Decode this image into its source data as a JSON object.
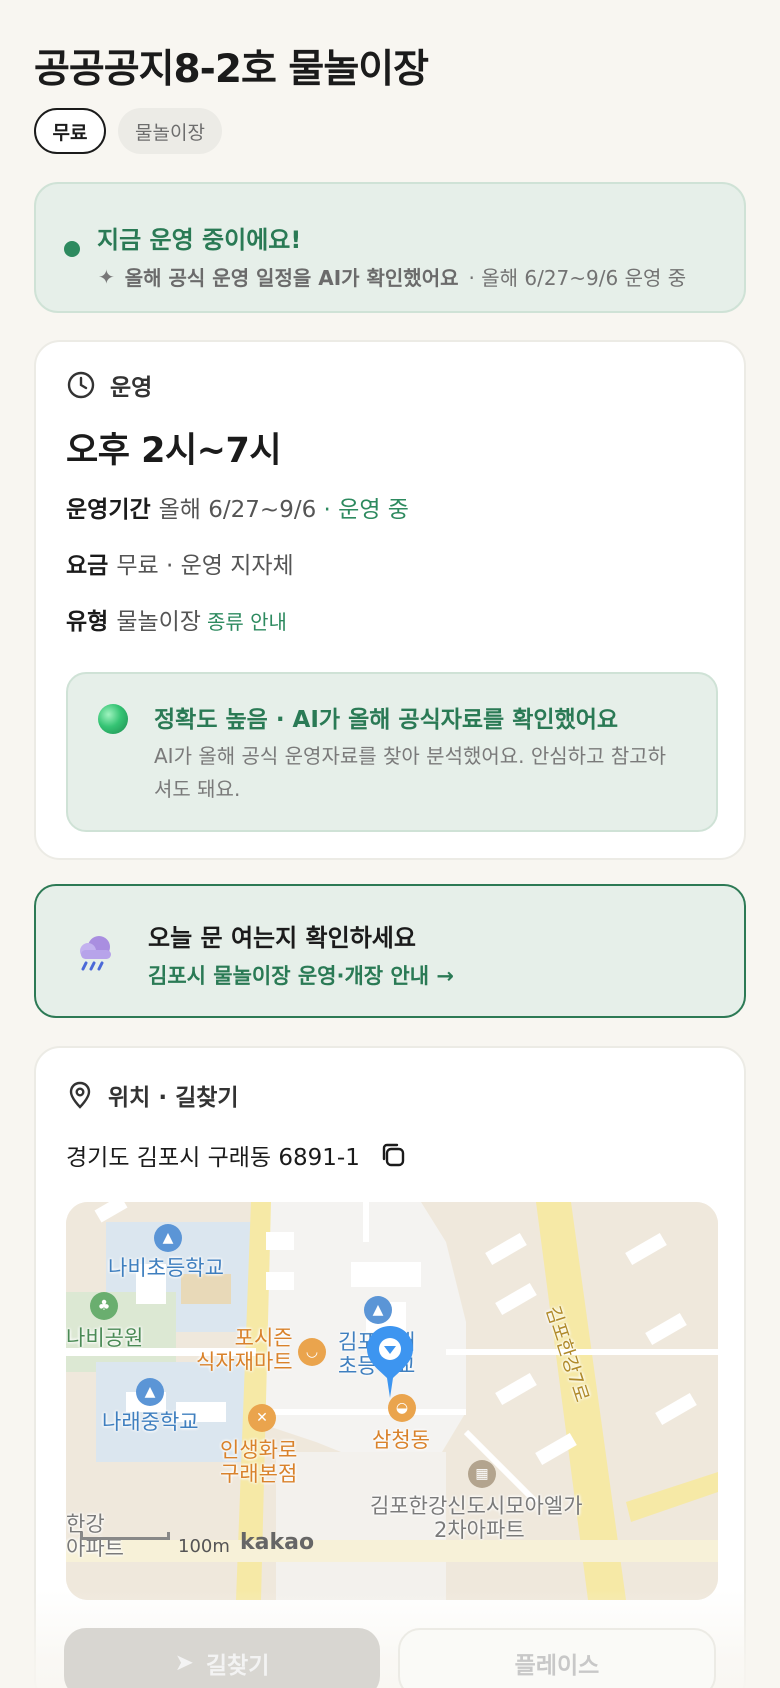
{
  "header": {
    "title": "공공공지8-2호 물놀이장",
    "chips": [
      "무료",
      "물놀이장"
    ]
  },
  "status": {
    "title": "지금 운영 중이에요!",
    "ai_note": "올해 공식 운영 일정을 AI가 확인했어요",
    "ai_note_suffix": "· 올해 6/27~9/6 운영 중"
  },
  "operation": {
    "section_label": "운영",
    "hours": "오후 2시~7시",
    "period_key": "운영기간",
    "period_value": "올해 6/27~9/6",
    "period_status": "· 운영 중",
    "fee_key": "요금",
    "fee_value": "무료 · 운영 지자체",
    "type_key": "유형",
    "type_value": "물놀이장",
    "type_link": "종류 안내",
    "accuracy_title": "정확도 높음 · AI가 올해 공식자료를 확인했어요",
    "accuracy_desc": "AI가 올해 공식 운영자료를 찾아 분석했어요. 안심하고 참고하셔도 돼요."
  },
  "check_banner": {
    "title": "오늘 문 여는지 확인하세요",
    "link": "김포시 물놀이장 운영·개장 안내 →"
  },
  "location": {
    "section_label": "위치 · 길찾기",
    "address": "경기도 김포시 구래동 6891-1",
    "map": {
      "labels": {
        "school1": "나비초등학교",
        "park": "나비공원",
        "school2": "나래중학교",
        "mart": "포시즌\n식자재마트",
        "school3a": "김포구래",
        "school3b": "초등학교",
        "restaurant_a": "인생화로",
        "restaurant_b": "구래본점",
        "cafe": "삼청동",
        "apt_a": "김포한강신도시모아엘가",
        "apt_b": "2차아파트",
        "road": "김포한강7로",
        "left_a": "한강",
        "left_b": "아파트",
        "scale": "100m",
        "brand": "kakao"
      }
    }
  },
  "actions": {
    "navigate": "길찾기",
    "place": "플레이스"
  },
  "colors": {
    "accent_green": "#2d8a5f",
    "background": "#f8f6f1",
    "status_bg": "#e6efe9"
  }
}
